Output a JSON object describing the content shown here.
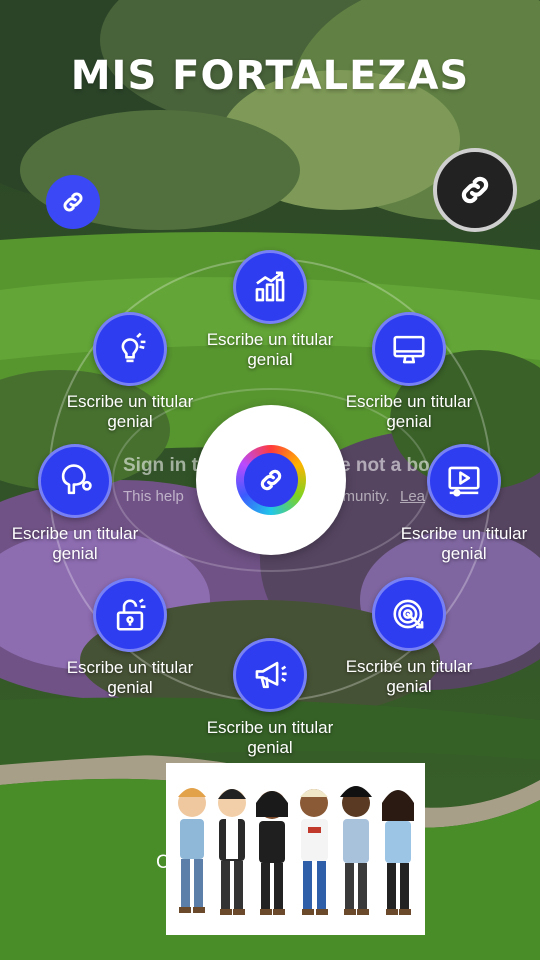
{
  "title": "MIS FORTALEZAS",
  "strengths": [
    {
      "icon": "bar-chart-icon",
      "label": "Escribe un titular genial"
    },
    {
      "icon": "monitor-icon",
      "label": "Escribe un titular genial"
    },
    {
      "icon": "video-player-icon",
      "label": "Escribe un titular genial"
    },
    {
      "icon": "target-icon",
      "label": "Escribe un titular genial"
    },
    {
      "icon": "megaphone-icon",
      "label": "Escribe un titular genial"
    },
    {
      "icon": "unlock-icon",
      "label": "Escribe un titular genial"
    },
    {
      "icon": "ping-pong-icon",
      "label": "Escribe un titular genial"
    },
    {
      "icon": "lightbulb-icon",
      "label": "Escribe un titular genial"
    }
  ],
  "background_text": {
    "heading_left": "Sign in t",
    "heading_right": "e not a bo",
    "body_left": "This help",
    "body_mid": "mmunity.",
    "body_link": "Lea",
    "caption": "C"
  },
  "colors": {
    "accent": "#2f3df0",
    "title": "#ffffff"
  }
}
